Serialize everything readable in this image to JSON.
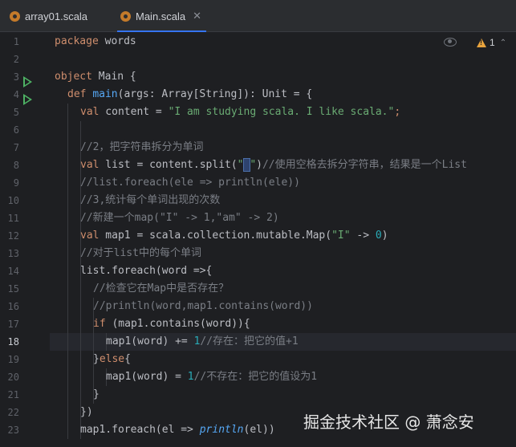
{
  "tabs": [
    {
      "label": "array01.scala",
      "active": false
    },
    {
      "label": "Main.scala",
      "active": true
    }
  ],
  "editor": {
    "inspection_warning_count": "1",
    "current_line": 18,
    "line_numbers": [
      "1",
      "2",
      "3",
      "4",
      "5",
      "6",
      "7",
      "8",
      "9",
      "10",
      "11",
      "12",
      "13",
      "14",
      "15",
      "16",
      "17",
      "18",
      "19",
      "20",
      "21",
      "22",
      "23"
    ],
    "code": {
      "l1_kw": "package",
      "l1_rest": " words",
      "l3_kw": "object",
      "l3_rest": " Main {",
      "l4_kw": "def",
      "l4_fn": "main",
      "l4_rest": "(args: Array[String]): Unit = {",
      "l5_kw": "val",
      "l5_rest": " content = ",
      "l5_str": "\"I am studying scala. I like scala.\"",
      "l5_end": ";",
      "l7_cm": "//2，把字符串拆分为单词",
      "l8_kw": "val",
      "l8_rest": " list = content.split(",
      "l8_q1": "\"",
      "l8_sel": " ",
      "l8_q2": "\"",
      "l8_close": ")",
      "l8_cm": "//使用空格去拆分字符串，结果是一个List",
      "l9_cm": "//list.foreach(ele => println(ele))",
      "l10_cm": "//3,统计每个单词出现的次数",
      "l11_cm": "//新建一个map(\"I\" -> 1,\"am\" -> 2)",
      "l12_kw": "val",
      "l12_rest": " map1 = scala.collection.mutable.Map(",
      "l12_str": "\"I\"",
      "l12_mid": " -> ",
      "l12_num": "0",
      "l12_end": ")",
      "l13_cm": "//对于list中的每个单词",
      "l14_text": "list.foreach(word =>{",
      "l15_cm": "//检查它在Map中是否存在？",
      "l16_cm": "//println(word,map1.contains(word))",
      "l17_kw": "if",
      "l17_rest": " (map1.contains(word)){",
      "l18_rest": "map1(word) += ",
      "l18_num": "1",
      "l18_cm": "//存在：把它的值+1",
      "l19_a": "}",
      "l19_kw": "else",
      "l19_b": "{",
      "l20_rest": "map1(word) = ",
      "l20_num": "1",
      "l20_cm": "//不存在：把它的值设为1",
      "l21_text": "}",
      "l22_text": "})",
      "l23_rest": "map1.foreach(el => ",
      "l23_it": "println",
      "l23_end": "(el))"
    }
  },
  "watermark": "掘金技术社区 @ 萧念安",
  "icons": [
    "scala-file-icon",
    "close-icon",
    "run-gutter-icon",
    "eye-icon",
    "warning-icon",
    "chevron-up-icon",
    "intention-bulb-icon"
  ],
  "colors": {
    "keyword": "#cf8e6d",
    "function": "#56a8f5",
    "string": "#6aab73",
    "number": "#2aacb8",
    "comment": "#7a7e85",
    "run": "#4eb264",
    "warning": "#e8a33d"
  }
}
